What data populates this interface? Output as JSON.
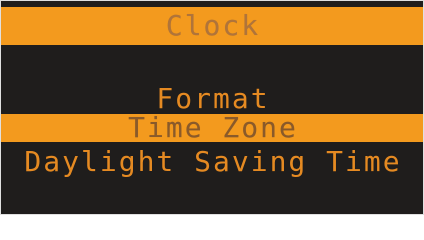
{
  "header": {
    "title": "Clock"
  },
  "menu": {
    "items": [
      {
        "label": "Format",
        "selected": false
      },
      {
        "label": "Time Zone",
        "selected": true
      },
      {
        "label": "Daylight Saving Time",
        "selected": false
      }
    ]
  },
  "colors": {
    "background": "#1f1d1c",
    "accent": "#f39a1e",
    "text": "#e58a22",
    "selected_text": "#8a5a2a"
  }
}
